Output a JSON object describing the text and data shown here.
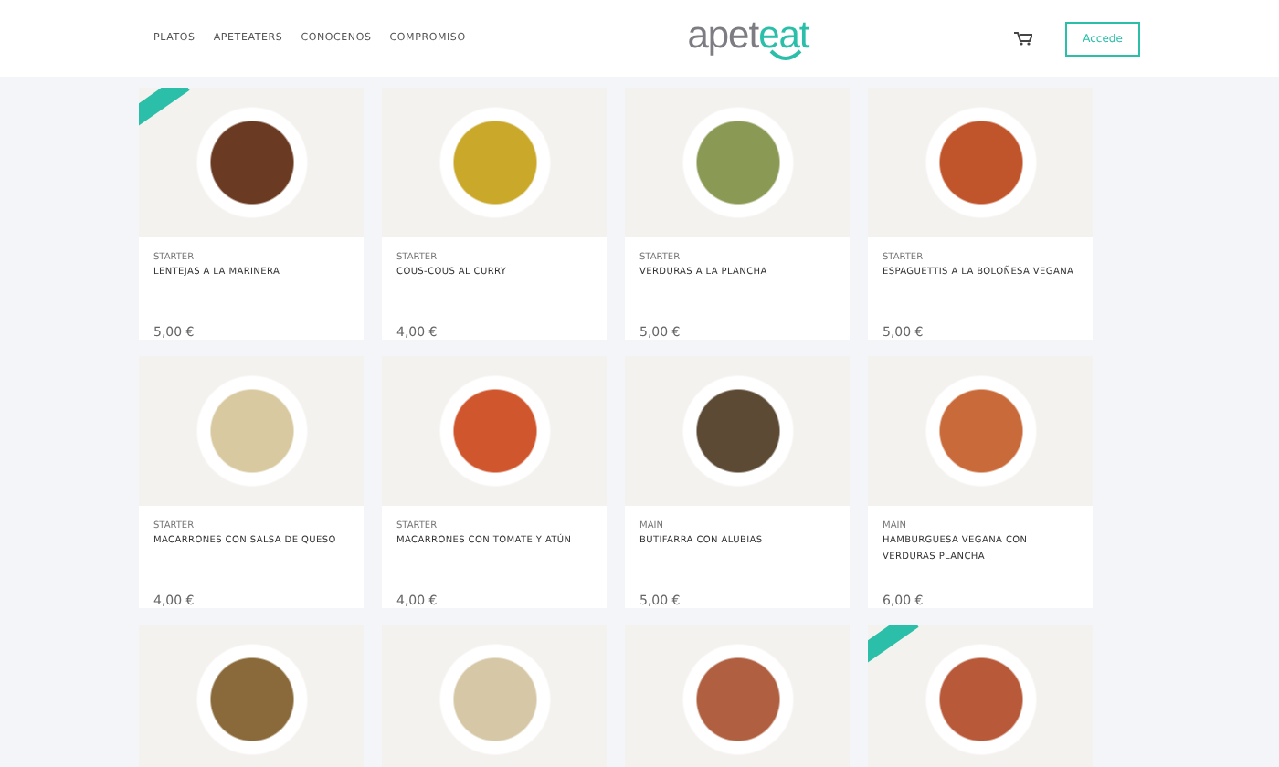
{
  "nav": {
    "links": [
      "PLATOS",
      "APETEATERS",
      "CONOCENOS",
      "COMPROMISO"
    ],
    "logo": {
      "part_1": "apet",
      "part_2": "eat"
    },
    "login_button": "Accede"
  },
  "products": [
    {
      "new": true,
      "category": "STARTER",
      "name": "LENTEJAS A LA MARINERA",
      "price": "5,00 €"
    },
    {
      "new": false,
      "category": "STARTER",
      "name": "COUS-COUS AL CURRY",
      "price": "4,00 €"
    },
    {
      "new": false,
      "category": "STARTER",
      "name": "VERDURAS A LA PLANCHA",
      "price": "5,00 €"
    },
    {
      "new": false,
      "category": "STARTER",
      "name": "ESPAGUETTIS A LA BOLOÑESA VEGANA",
      "price": "5,00 €"
    },
    {
      "new": false,
      "category": "STARTER",
      "name": "MACARRONES CON SALSA DE QUESO",
      "price": "4,00 €"
    },
    {
      "new": false,
      "category": "STARTER",
      "name": "MACARRONES CON TOMATE Y ATÚN",
      "price": "4,00 €"
    },
    {
      "new": false,
      "category": "MAIN",
      "name": "BUTIFARRA CON ALUBIAS",
      "price": "5,00 €"
    },
    {
      "new": false,
      "category": "MAIN",
      "name": "HAMBURGUESA VEGANA CON VERDURAS PLANCHA",
      "price": "6,00 €"
    },
    {
      "new": false
    },
    {
      "new": false
    },
    {
      "new": false
    },
    {
      "new": true
    }
  ]
}
